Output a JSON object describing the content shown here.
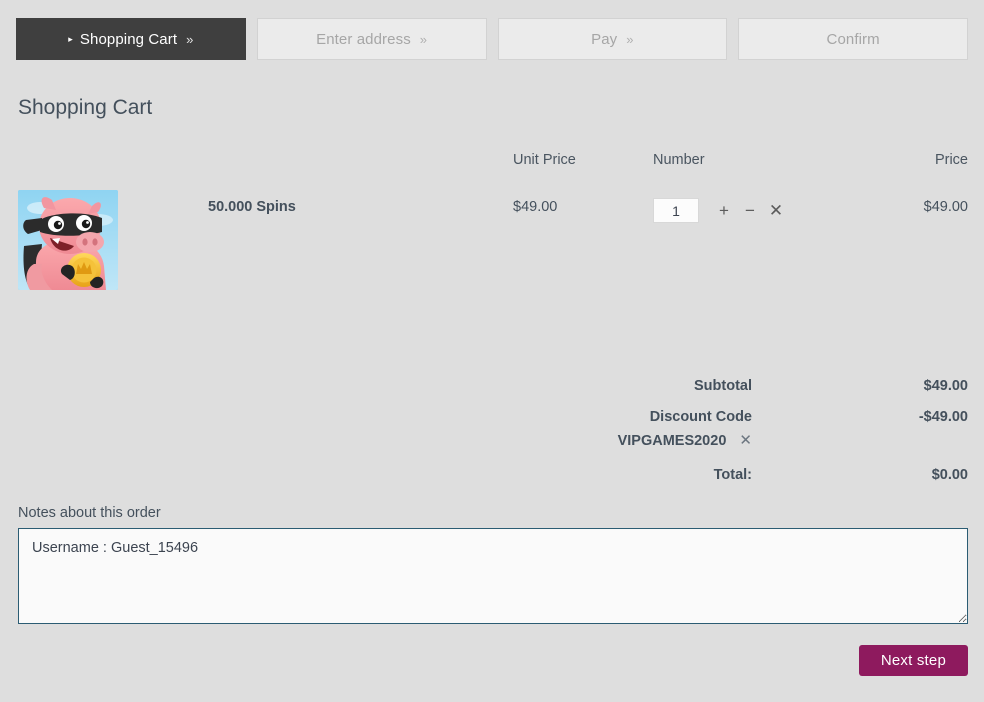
{
  "theme": {
    "page_bg": "#dedede",
    "active_step_bg": "#3f3f3f",
    "inactive_step_bg": "#ebebeb",
    "text_color": "#44505c",
    "muted_text": "#a6a6a6",
    "accent_button": "#8e1a5e",
    "textarea_border": "#2b5c73"
  },
  "steps": [
    {
      "label": "Shopping Cart",
      "chevron": "»",
      "caret": "▸",
      "active": true
    },
    {
      "label": "Enter address",
      "chevron": "»",
      "active": false
    },
    {
      "label": "Pay",
      "chevron": "»",
      "active": false
    },
    {
      "label": "Confirm",
      "chevron": "",
      "active": false
    }
  ],
  "page": {
    "title": "Shopping Cart"
  },
  "cart": {
    "headers": {
      "unit_price": "Unit Price",
      "number": "Number",
      "price": "Price"
    },
    "item": {
      "name": "50.000 Spins",
      "unit_price": "$49.00",
      "quantity": "1",
      "price": "$49.00",
      "thumbnail_alt": "coin-master-pig-thumbnail",
      "increase_icon": "+",
      "decrease_icon": "−",
      "remove_icon": "✕"
    }
  },
  "totals": {
    "subtotal_label": "Subtotal",
    "subtotal_value": "$49.00",
    "discount_label": "Discount Code",
    "discount_code": "VIPGAMES2020",
    "discount_remove_icon": "✕",
    "discount_value": "-$49.00",
    "total_label": "Total:",
    "total_value": "$0.00"
  },
  "notes": {
    "label": "Notes about this order",
    "value": "Username : Guest_15496",
    "placeholder": ""
  },
  "footer": {
    "next_label": "Next step"
  }
}
